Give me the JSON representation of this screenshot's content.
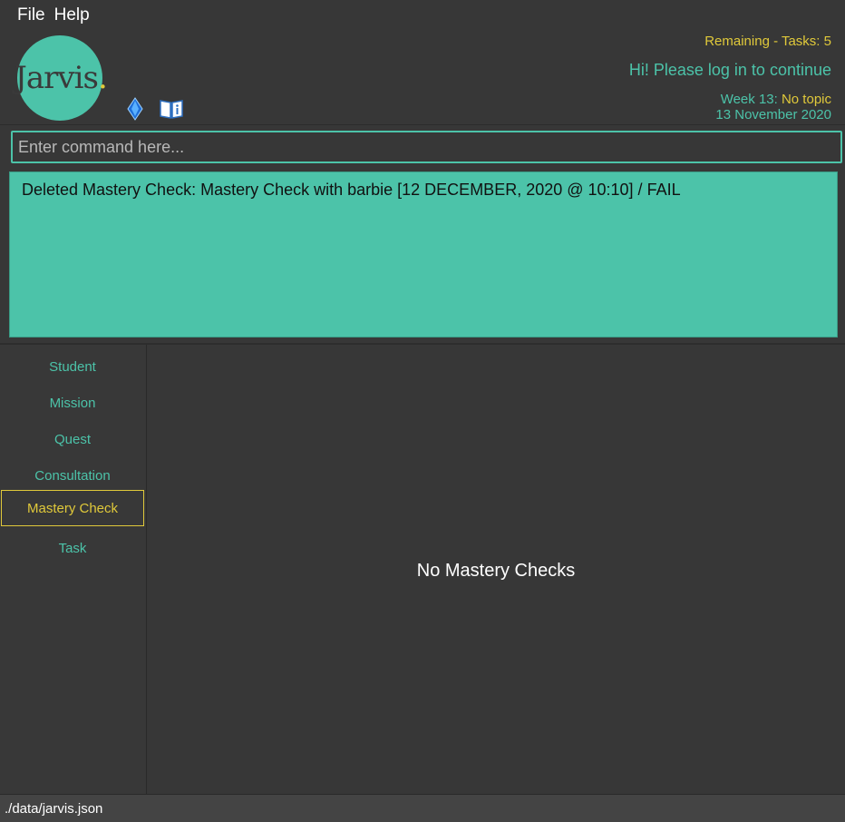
{
  "menu": {
    "file": "File",
    "help": "Help"
  },
  "logo": {
    "main": "Jarvis",
    "dot": "."
  },
  "header": {
    "remaining": "Remaining - Tasks: 5",
    "greeting": "Hi! Please log in to continue",
    "week_label": "Week 13:",
    "week_topic": "No topic",
    "date": "13 November 2020"
  },
  "command": {
    "placeholder": "Enter command here...",
    "value": ""
  },
  "result": {
    "text": "Deleted Mastery Check: Mastery Check with barbie [12 DECEMBER, 2020 @ 10:10] / FAIL"
  },
  "sidebar": {
    "items": [
      {
        "label": "Student"
      },
      {
        "label": "Mission"
      },
      {
        "label": "Quest"
      },
      {
        "label": "Consultation"
      },
      {
        "label": "Mastery Check",
        "active": true
      },
      {
        "label": "Task"
      }
    ]
  },
  "main": {
    "empty_message": "No Mastery Checks"
  },
  "status": {
    "path": "./data/jarvis.json"
  },
  "icons": {
    "diamond": "diamond-icon",
    "manual": "book-info-icon"
  },
  "colors": {
    "accent": "#4cc3a9",
    "highlight": "#e0c93a",
    "background": "#373737"
  }
}
